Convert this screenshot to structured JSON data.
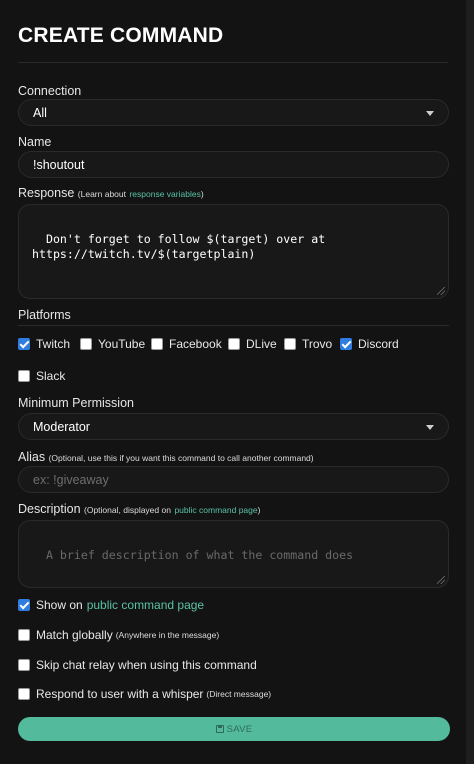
{
  "title": "CREATE COMMAND",
  "connection": {
    "label": "Connection",
    "value": "All"
  },
  "name": {
    "label": "Name",
    "value": "!shoutout"
  },
  "response": {
    "label": "Response",
    "hint_prefix": "(Learn about",
    "hint_link": "response variables",
    "hint_suffix": ")",
    "value": "Don't forget to follow $(target) over at\nhttps://twitch.tv/$(targetplain)"
  },
  "platforms": {
    "label": "Platforms",
    "items": [
      {
        "label": "Twitch",
        "checked": true
      },
      {
        "label": "YouTube",
        "checked": false
      },
      {
        "label": "Facebook",
        "checked": false
      },
      {
        "label": "DLive",
        "checked": false
      },
      {
        "label": "Trovo",
        "checked": false
      },
      {
        "label": "Discord",
        "checked": true
      },
      {
        "label": "Slack",
        "checked": false
      }
    ]
  },
  "permission": {
    "label": "Minimum Permission",
    "value": "Moderator"
  },
  "alias": {
    "label": "Alias",
    "hint": "(Optional, use this if you want this command to call another command)",
    "placeholder": "ex: !giveaway"
  },
  "description": {
    "label": "Description",
    "hint_prefix": "(Optional, displayed on",
    "hint_link": "public command page",
    "hint_suffix": ")",
    "placeholder": "A brief description of what the command does"
  },
  "options": {
    "show_public": {
      "label": "Show on",
      "link": "public command page",
      "checked": true
    },
    "match_globally": {
      "label": "Match globally",
      "hint": "(Anywhere in the message)",
      "checked": false
    },
    "skip_relay": {
      "label": "Skip chat relay when using this command",
      "checked": false
    },
    "whisper": {
      "label": "Respond to user with a whisper",
      "hint": "(Direct message)",
      "checked": false
    }
  },
  "save_label": "SAVE",
  "colors": {
    "accent": "#53bb9c",
    "link": "#59c2a6",
    "checkbox": "#2f7de1",
    "panel": "#131313"
  }
}
